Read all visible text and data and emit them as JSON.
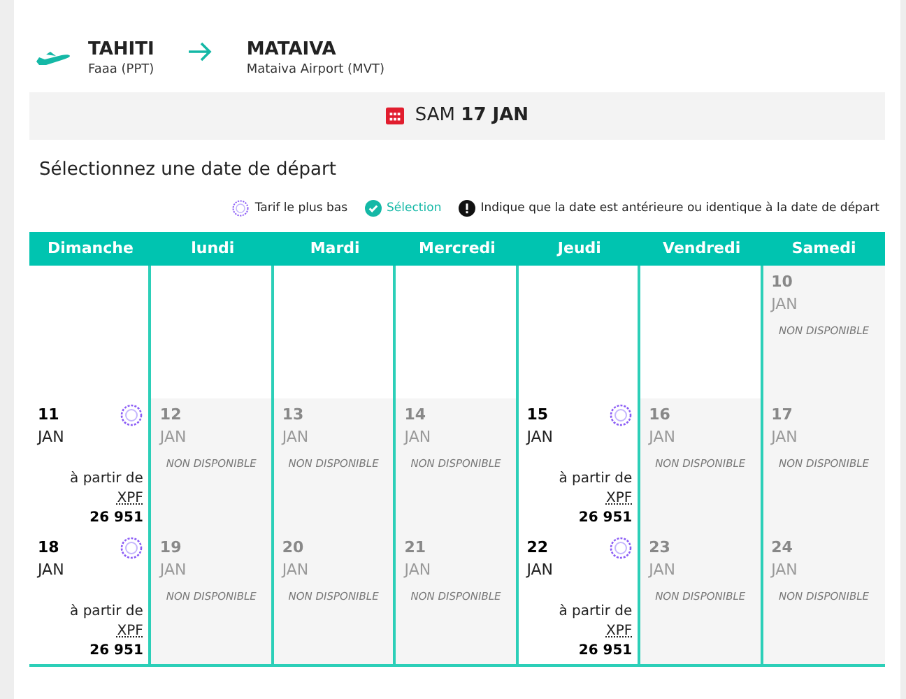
{
  "route": {
    "origin": {
      "city": "TAHITI",
      "airport": "Faaa (PPT)"
    },
    "destination": {
      "city": "MATAIVA",
      "airport": "Mataiva Airport (MVT)"
    }
  },
  "date_bar": {
    "weekday": "SAM",
    "date": "17 JAN"
  },
  "heading": "Sélectionnez une date de départ",
  "legend": [
    {
      "kind": "lowest",
      "label": "Tarif le plus bas"
    },
    {
      "kind": "selection",
      "label": "Sélection"
    },
    {
      "kind": "info",
      "label": "Indique que la date est antérieure ou identique à la date de départ"
    }
  ],
  "weekdays": [
    "Dimanche",
    "lundi",
    "Mardi",
    "Mercredi",
    "Jeudi",
    "Vendredi",
    "Samedi"
  ],
  "weeks": [
    [
      {
        "kind": "empty"
      },
      {
        "kind": "empty"
      },
      {
        "kind": "empty"
      },
      {
        "kind": "empty"
      },
      {
        "kind": "empty"
      },
      {
        "kind": "empty"
      },
      {
        "kind": "unavailable",
        "day": "10",
        "month": "JAN",
        "note": "NON DISPONIBLE"
      }
    ],
    [
      {
        "kind": "available",
        "day": "11",
        "month": "JAN",
        "lowest": true,
        "from": "à partir de",
        "currency": "XPF",
        "price": "26 951"
      },
      {
        "kind": "unavailable",
        "day": "12",
        "month": "JAN",
        "note": "NON DISPONIBLE"
      },
      {
        "kind": "unavailable",
        "day": "13",
        "month": "JAN",
        "note": "NON DISPONIBLE"
      },
      {
        "kind": "unavailable",
        "day": "14",
        "month": "JAN",
        "note": "NON DISPONIBLE"
      },
      {
        "kind": "available",
        "day": "15",
        "month": "JAN",
        "lowest": true,
        "from": "à partir de",
        "currency": "XPF",
        "price": "26 951"
      },
      {
        "kind": "unavailable",
        "day": "16",
        "month": "JAN",
        "note": "NON DISPONIBLE"
      },
      {
        "kind": "unavailable",
        "day": "17",
        "month": "JAN",
        "note": "NON DISPONIBLE"
      }
    ],
    [
      {
        "kind": "available",
        "day": "18",
        "month": "JAN",
        "lowest": true,
        "from": "à partir de",
        "currency": "XPF",
        "price": "26 951"
      },
      {
        "kind": "unavailable",
        "day": "19",
        "month": "JAN",
        "note": "NON DISPONIBLE"
      },
      {
        "kind": "unavailable",
        "day": "20",
        "month": "JAN",
        "note": "NON DISPONIBLE"
      },
      {
        "kind": "unavailable",
        "day": "21",
        "month": "JAN",
        "note": "NON DISPONIBLE"
      },
      {
        "kind": "available",
        "day": "22",
        "month": "JAN",
        "lowest": true,
        "from": "à partir de",
        "currency": "XPF",
        "price": "26 951"
      },
      {
        "kind": "unavailable",
        "day": "23",
        "month": "JAN",
        "note": "NON DISPONIBLE"
      },
      {
        "kind": "unavailable",
        "day": "24",
        "month": "JAN",
        "note": "NON DISPONIBLE"
      }
    ]
  ]
}
